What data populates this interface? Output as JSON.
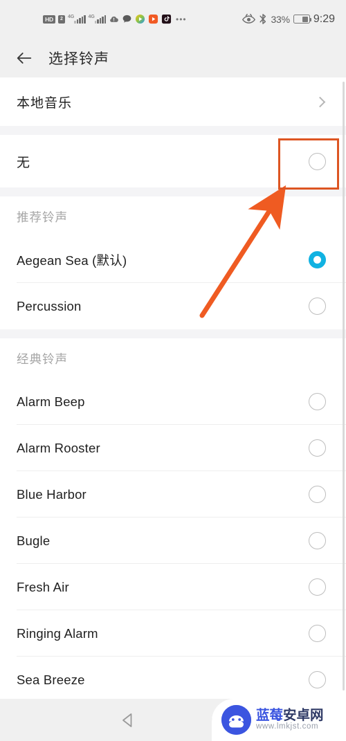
{
  "status_bar": {
    "hd_label": "HD",
    "volte_label": "2",
    "network_label_1": "4G",
    "network_label_2": "4G",
    "overflow_dots": "•••",
    "app_icons": [
      "cloud-icon",
      "chat-bubble-icon",
      "play-icon",
      "video-player-icon",
      "tiktok-icon"
    ],
    "eye_comfort_icon": "eye-comfort-icon",
    "bluetooth_icon": "bluetooth-icon",
    "battery_percent": "33%",
    "battery_icon": "battery-icon",
    "time": "9:29"
  },
  "app_bar": {
    "back_icon": "back-arrow-icon",
    "title": "选择铃声"
  },
  "list": {
    "local_music": {
      "label": "本地音乐",
      "chevron_icon": "chevron-right-icon"
    },
    "none_item": {
      "label": "无",
      "selected": false
    },
    "sections": [
      {
        "header": "推荐铃声",
        "items": [
          {
            "label": "Aegean Sea (默认)",
            "selected": true
          },
          {
            "label": "Percussion",
            "selected": false
          }
        ]
      },
      {
        "header": "经典铃声",
        "items": [
          {
            "label": "Alarm Beep",
            "selected": false
          },
          {
            "label": "Alarm Rooster",
            "selected": false
          },
          {
            "label": "Blue Harbor",
            "selected": false
          },
          {
            "label": "Bugle",
            "selected": false
          },
          {
            "label": "Fresh Air",
            "selected": false
          },
          {
            "label": "Ringing Alarm",
            "selected": false
          },
          {
            "label": "Sea Breeze",
            "selected": false
          }
        ]
      }
    ]
  },
  "annotations": {
    "highlight_box_target": "无 radio button",
    "arrow": "points to highlighted radio button",
    "accent_color": "#dd5522"
  },
  "nav_bar": {
    "back_icon": "nav-back-triangle-icon",
    "home_icon": "nav-home-circle-icon"
  },
  "watermark": {
    "logo_icon": "android-robot-logo-icon",
    "name_part1": "蓝莓",
    "name_part2": "安卓网",
    "url": "www.lmkjst.com"
  },
  "colors": {
    "selected_radio": "#11b2e2",
    "annotation": "#dd5522",
    "chrome_bg": "#f0f0f0",
    "watermark_blue": "#3b55e0"
  }
}
